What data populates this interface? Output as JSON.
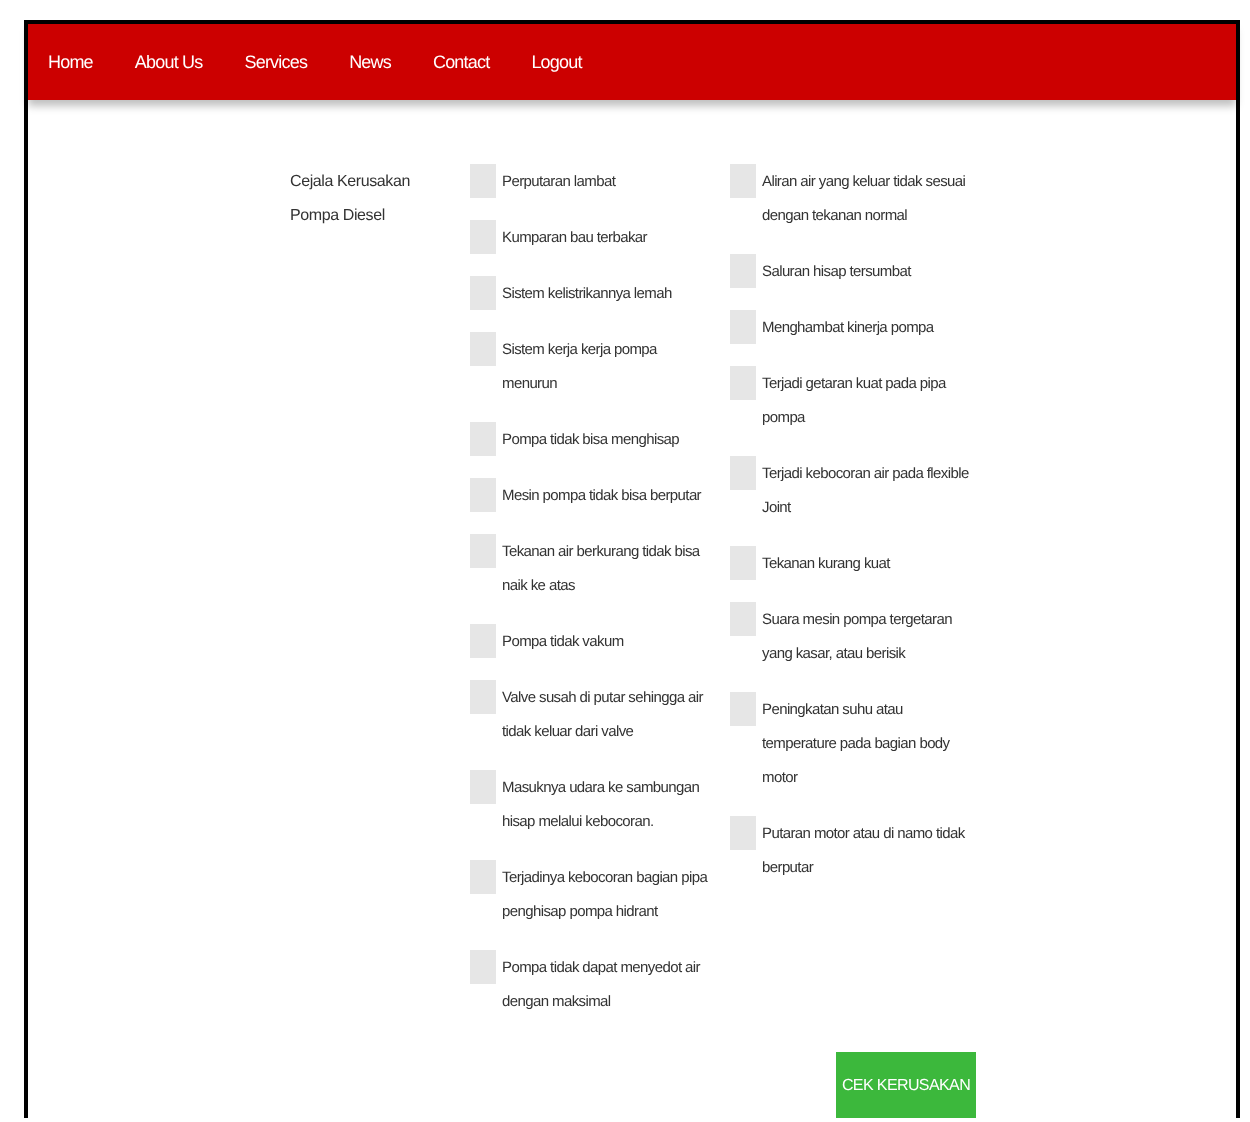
{
  "nav": [
    {
      "label": "Home"
    },
    {
      "label": "About Us"
    },
    {
      "label": "Services"
    },
    {
      "label": "News"
    },
    {
      "label": "Contact"
    },
    {
      "label": "Logout"
    }
  ],
  "form": {
    "label": "Cejala Kerusakan Pompa Diesel",
    "columns": [
      [
        {
          "text": "Perputaran lambat",
          "checked": false
        },
        {
          "text": "Kumparan bau terbakar",
          "checked": false
        },
        {
          "text": "Sistem kelistrikannya lemah",
          "checked": false
        },
        {
          "text": "Sistem kerja kerja pompa menurun",
          "checked": false
        },
        {
          "text": "Pompa tidak bisa menghisap",
          "checked": false
        },
        {
          "text": "Mesin pompa tidak bisa berputar",
          "checked": false
        },
        {
          "text": "Tekanan air berkurang tidak bisa naik ke atas",
          "checked": false
        },
        {
          "text": "Pompa tidak vakum",
          "checked": false
        },
        {
          "text": "Valve susah di putar sehingga air tidak keluar dari valve",
          "checked": false
        },
        {
          "text": "Masuknya udara ke sambungan hisap melalui kebocoran.",
          "checked": false
        },
        {
          "text": "Terjadinya kebocoran bagian pipa penghisap pompa hidrant",
          "checked": false
        },
        {
          "text": "Pompa tidak dapat menyedot air dengan maksimal",
          "checked": false
        }
      ],
      [
        {
          "text": "Aliran air yang keluar tidak sesuai dengan tekanan normal",
          "checked": false
        },
        {
          "text": "Saluran hisap tersumbat",
          "checked": false
        },
        {
          "text": "Menghambat kinerja pompa",
          "checked": false
        },
        {
          "text": "Terjadi getaran kuat pada pipa pompa",
          "checked": false
        },
        {
          "text": "Terjadi kebocoran air pada flexible Joint",
          "checked": false
        },
        {
          "text": "Tekanan kurang kuat",
          "checked": false
        },
        {
          "text": "Suara mesin pompa tergetaran yang kasar, atau berisik",
          "checked": false
        },
        {
          "text": "Peningkatan suhu atau temperature pada bagian body motor",
          "checked": false
        },
        {
          "text": "Putaran motor atau di namo tidak berputar",
          "checked": false
        }
      ]
    ]
  },
  "submit": {
    "label": "CEK KERUSAKAN"
  }
}
